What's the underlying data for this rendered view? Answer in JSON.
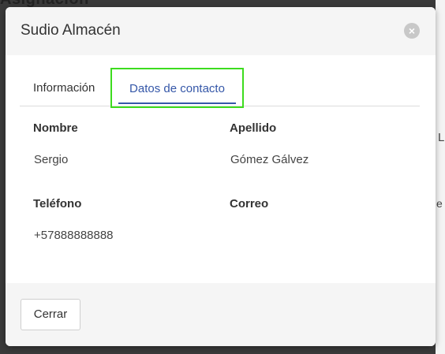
{
  "background": {
    "title": "Asignación",
    "right_letter_1": "L",
    "right_letter_2": "e"
  },
  "modal": {
    "title": "Sudio Almacén",
    "close_icon": "close-icon",
    "tabs": [
      {
        "label": "Información",
        "active": false
      },
      {
        "label": "Datos de contacto",
        "active": true
      }
    ],
    "fields": {
      "nombre_label": "Nombre",
      "nombre_value": "Sergio",
      "apellido_label": "Apellido",
      "apellido_value": "Gómez Gálvez",
      "telefono_label": "Teléfono",
      "telefono_value": "+57888888888",
      "correo_label": "Correo",
      "correo_value": ""
    },
    "footer": {
      "close_label": "Cerrar"
    }
  },
  "colors": {
    "active_tab": "#3557a8",
    "highlight_border": "#3ddc1e",
    "overlay": "#3a3a3a"
  }
}
